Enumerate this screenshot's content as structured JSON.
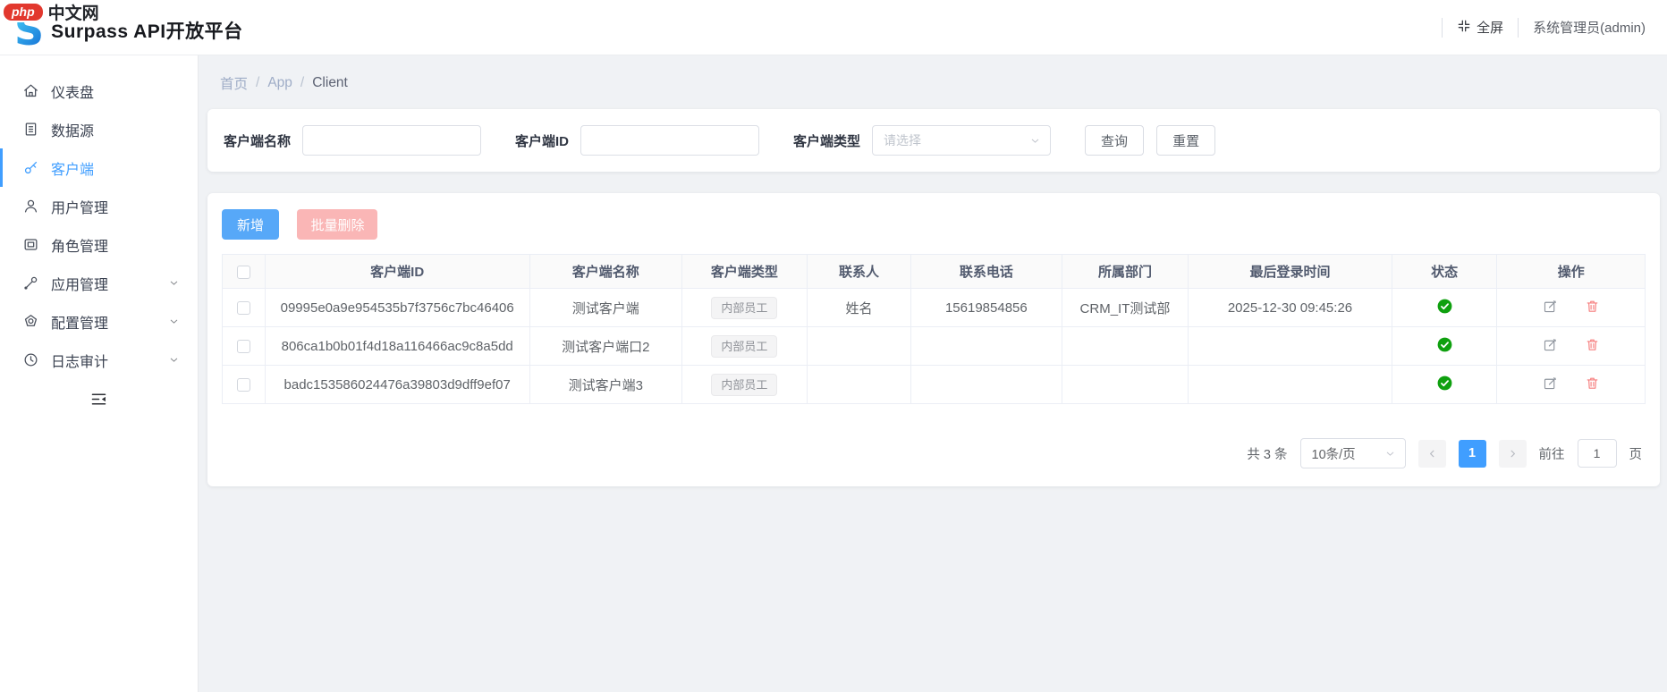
{
  "watermark": {
    "php_label": "php",
    "site_label": "中文网"
  },
  "header": {
    "title": "Surpass API开放平台",
    "fullscreen_label": "全屏",
    "user": "系统管理员(admin)"
  },
  "sidebar": {
    "items": [
      {
        "label": "仪表盘",
        "icon": "home-icon",
        "active": false,
        "expandable": false
      },
      {
        "label": "数据源",
        "icon": "datasource-icon",
        "active": false,
        "expandable": false
      },
      {
        "label": "客户端",
        "icon": "key-icon",
        "active": true,
        "expandable": false
      },
      {
        "label": "用户管理",
        "icon": "user-icon",
        "active": false,
        "expandable": false
      },
      {
        "label": "角色管理",
        "icon": "role-icon",
        "active": false,
        "expandable": false
      },
      {
        "label": "应用管理",
        "icon": "wrench-icon",
        "active": false,
        "expandable": true
      },
      {
        "label": "配置管理",
        "icon": "config-icon",
        "active": false,
        "expandable": true
      },
      {
        "label": "日志审计",
        "icon": "clock-icon",
        "active": false,
        "expandable": true
      }
    ]
  },
  "breadcrumb": {
    "items": [
      "首页",
      "App",
      "Client"
    ],
    "separator": "/"
  },
  "search": {
    "name_label": "客户端名称",
    "id_label": "客户端ID",
    "type_label": "客户端类型",
    "type_placeholder": "请选择",
    "query_label": "查询",
    "reset_label": "重置"
  },
  "toolbar": {
    "add_label": "新增",
    "batch_delete_label": "批量删除"
  },
  "table": {
    "columns": [
      "客户端ID",
      "客户端名称",
      "客户端类型",
      "联系人",
      "联系电话",
      "所属部门",
      "最后登录时间",
      "状态",
      "操作"
    ],
    "rows": [
      {
        "id": "09995e0a9e954535b7f3756c7bc46406",
        "name": "测试客户端",
        "type": "内部员工",
        "contact": "姓名",
        "phone": "15619854856",
        "dept": "CRM_IT测试部",
        "last_login": "2025-12-30 09:45:26",
        "status": "enabled"
      },
      {
        "id": "806ca1b0b01f4d18a116466ac9c8a5dd",
        "name": "测试客户端口2",
        "type": "内部员工",
        "contact": "",
        "phone": "",
        "dept": "",
        "last_login": "",
        "status": "enabled"
      },
      {
        "id": "badc153586024476a39803d9dff9ef07",
        "name": "测试客户端3",
        "type": "内部员工",
        "contact": "",
        "phone": "",
        "dept": "",
        "last_login": "",
        "status": "enabled"
      }
    ]
  },
  "pagination": {
    "total_label": "共 3 条",
    "page_size": "10条/页",
    "current_page": "1",
    "goto_label": "前往",
    "goto_value": "1",
    "page_unit": "页"
  },
  "colors": {
    "accent": "#409eff",
    "add_button": "#57a8f8",
    "disabled_danger": "#fab6b6",
    "success_status": "#0fa00f",
    "danger_icon": "#f56c6c"
  }
}
